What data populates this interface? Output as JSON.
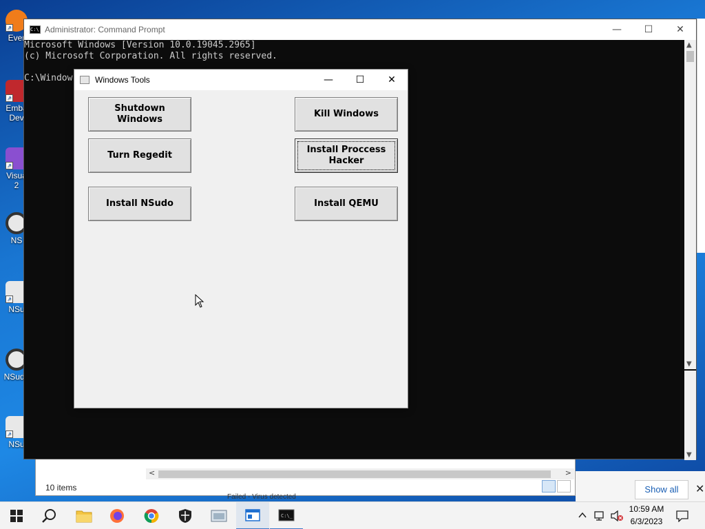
{
  "desktop": {
    "icons": [
      {
        "label": "Ever",
        "color": "#f07c1a"
      },
      {
        "label": "Emba\nDev",
        "color": "#c0282d"
      },
      {
        "label": "Visua\n2",
        "color": "#8a4fd0"
      },
      {
        "label": "NS",
        "color": "#333333"
      },
      {
        "label": "NSu",
        "color": "#2a6fd0"
      },
      {
        "label": "NSudo",
        "color": "#333333"
      },
      {
        "label": "NSu",
        "color": "#2a6fd0"
      }
    ]
  },
  "cmd": {
    "title": "Administrator:  Command Prompt",
    "lines": [
      "Microsoft Windows [Version 10.0.19045.2965]",
      "(c) Microsoft Corporation. All rights reserved.",
      "",
      "C:\\Window"
    ],
    "controls": {
      "minimize": "—",
      "maximize": "☐",
      "close": "✕"
    }
  },
  "explorer": {
    "status": "10 items",
    "failed_text": "Failed - Virus detected"
  },
  "notification": {
    "show_all": "Show all",
    "close": "✕"
  },
  "tools": {
    "title": "Windows Tools",
    "controls": {
      "minimize": "—",
      "maximize": "☐",
      "close": "✕"
    },
    "buttons": {
      "shutdown": "Shutdown Windows",
      "kill": "Kill Windows",
      "regedit": "Turn Regedit",
      "process_hacker": "Install Proccess Hacker",
      "nsudo": "Install NSudo",
      "qemu": "Install QEMU"
    }
  },
  "taskbar": {
    "time": "10:59 AM",
    "date": "6/3/2023"
  },
  "colors": {
    "accent": "#3b78c8",
    "console_bg": "#0c0c0c",
    "console_fg": "#cccccc"
  }
}
